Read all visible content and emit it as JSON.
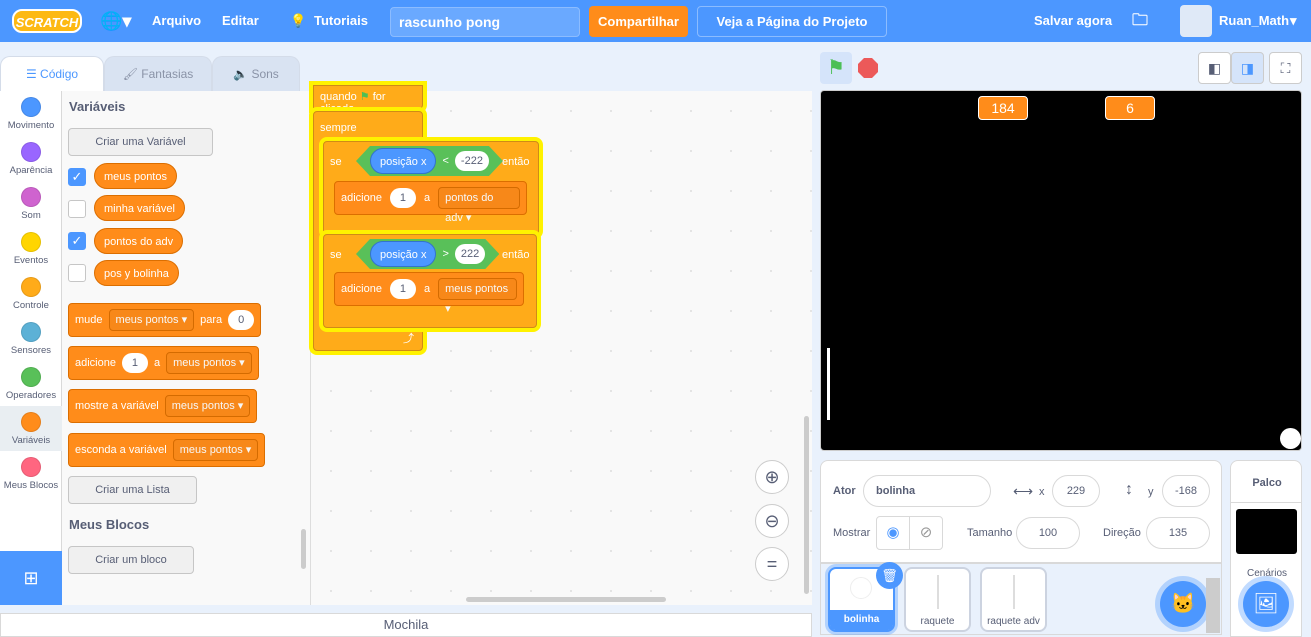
{
  "menu": {
    "logo": "SCRATCH",
    "arquivo": "Arquivo",
    "editar": "Editar",
    "tutoriais": "Tutoriais",
    "project_title": "rascunho pong",
    "share": "Compartilhar",
    "project_page": "Veja a Página do Projeto",
    "save_now": "Salvar agora",
    "username": "Ruan_Math"
  },
  "tabs": [
    {
      "label": "Código",
      "active": true
    },
    {
      "label": "Fantasias"
    },
    {
      "label": "Sons"
    }
  ],
  "categories": [
    {
      "label": "Movimento",
      "color": "#4c97ff"
    },
    {
      "label": "Aparência",
      "color": "#9966ff"
    },
    {
      "label": "Som",
      "color": "#cf63cf"
    },
    {
      "label": "Eventos",
      "color": "#ffd500"
    },
    {
      "label": "Controle",
      "color": "#ffab19"
    },
    {
      "label": "Sensores",
      "color": "#5cb1d6"
    },
    {
      "label": "Operadores",
      "color": "#59c059"
    },
    {
      "label": "Variáveis",
      "color": "#ff8c1a",
      "selected": true
    },
    {
      "label": "Meus Blocos",
      "color": "#ff6680"
    }
  ],
  "palette": {
    "variables_heading": "Variáveis",
    "make_variable": "Criar uma Variável",
    "variables": [
      {
        "name": "meus pontos",
        "checked": true
      },
      {
        "name": "minha variável",
        "checked": false
      },
      {
        "name": "pontos do adv",
        "checked": true
      },
      {
        "name": "pos y bolinha",
        "checked": false
      }
    ],
    "set_block": {
      "label": "mude",
      "var": "meus pontos",
      "to": "para",
      "value": "0"
    },
    "change_block": {
      "label": "adicione",
      "value": "1",
      "a": "a",
      "var": "meus pontos"
    },
    "show_block": {
      "label": "mostre a variável",
      "var": "meus pontos"
    },
    "hide_block": {
      "label": "esconda a variável",
      "var": "meus pontos"
    },
    "make_list": "Criar uma Lista",
    "my_blocks_heading": "Meus Blocos",
    "make_block": "Criar um bloco"
  },
  "script": {
    "hat_when": "quando",
    "hat_clicked": "for clicado",
    "forever": "sempre",
    "if1": {
      "se": "se",
      "reporter": "posição x",
      "op": "<",
      "value": "-222",
      "then": "então",
      "action": "adicione",
      "amount": "1",
      "a": "a",
      "var": "pontos do adv"
    },
    "if2": {
      "se": "se",
      "reporter": "posição x",
      "op": ">",
      "value": "222",
      "then": "então",
      "action": "adicione",
      "amount": "1",
      "a": "a",
      "var": "meus pontos"
    }
  },
  "stage": {
    "monitor1": "184",
    "monitor2": "6"
  },
  "sprite_info": {
    "actor_label": "Ator",
    "actor_name": "bolinha",
    "x_label": "x",
    "x": "229",
    "y_label": "y",
    "y": "-168",
    "show_label": "Mostrar",
    "size_label": "Tamanho",
    "size": "100",
    "direction_label": "Direção",
    "direction": "135"
  },
  "sprites": [
    {
      "name": "bolinha",
      "selected": true
    },
    {
      "name": "raquete"
    },
    {
      "name": "raquete adv"
    }
  ],
  "stage_panel": {
    "title": "Palco",
    "backdrops": "Cenários"
  },
  "backpack": "Mochila"
}
